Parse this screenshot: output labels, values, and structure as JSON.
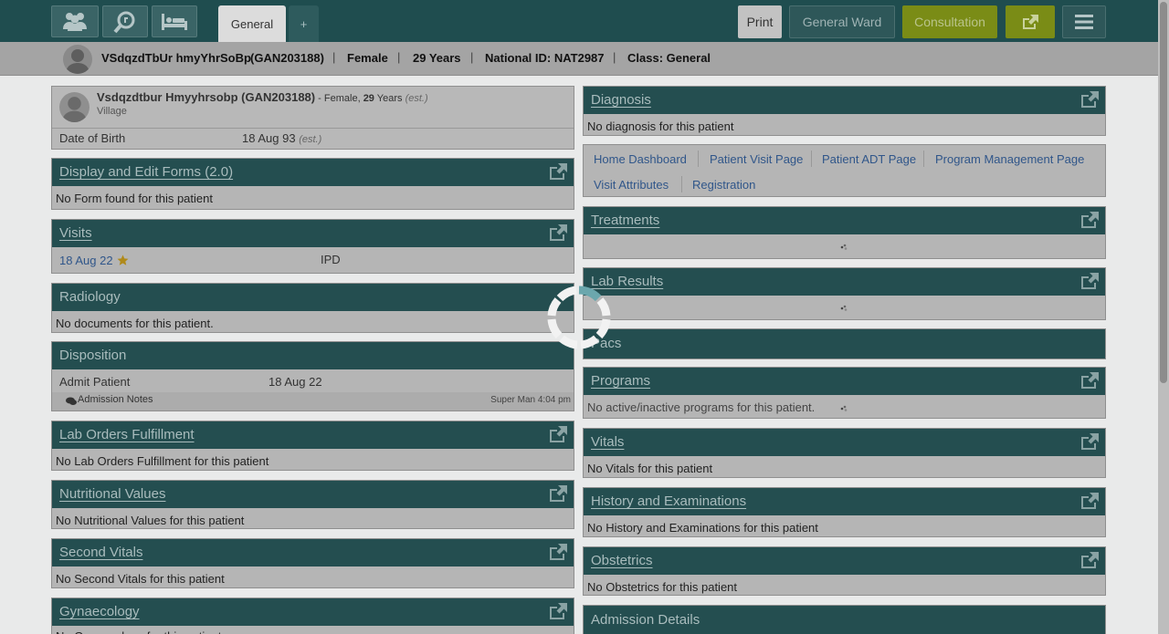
{
  "topnav": {
    "tabs": [
      "General",
      "+"
    ],
    "print": "Print",
    "ward": "General Ward",
    "consultation": "Consultation"
  },
  "patient_bar": {
    "name": "VSdqzdTbUr hmyYhrSoBp",
    "id": "(GAN203188)",
    "gender": "Female",
    "age": "29 Years",
    "national_id": "National ID: NAT2987",
    "class": "Class: General"
  },
  "patient_card": {
    "name": "Vsdqzdtbur Hmyyhrsobp (GAN203188)",
    "suffix_gender": " - Female, ",
    "age_num": "29",
    "age_word": " Years ",
    "est": "(est.)",
    "village": "Village",
    "dob_label": "Date of Birth",
    "dob_value": "18 Aug 93",
    "dob_est": "(est.)"
  },
  "left": {
    "forms": {
      "title": "Display and Edit Forms (2.0)",
      "body": "No Form found for this patient"
    },
    "visits": {
      "title": "Visits",
      "date": "18 Aug 22",
      "type": "IPD"
    },
    "radiology": {
      "title": "Radiology",
      "body": "No documents for this patient."
    },
    "disposition": {
      "title": "Disposition",
      "action": "Admit Patient",
      "date": "18 Aug 22",
      "notes": "Admission Notes",
      "by": "Super Man 4:04 pm"
    },
    "lab_orders": {
      "title": "Lab Orders Fulfillment",
      "body": "No Lab Orders Fulfillment for this patient"
    },
    "nutritional": {
      "title": "Nutritional Values",
      "body": "No Nutritional Values for this patient"
    },
    "second_vitals": {
      "title": "Second Vitals",
      "body": "No Second Vitals for this patient"
    },
    "gynaecology": {
      "title": "Gynaecology",
      "body": "No Gynaecology for this patient"
    }
  },
  "right": {
    "diagnosis": {
      "title": "Diagnosis",
      "body": "No diagnosis for this patient"
    },
    "dashboard_links": [
      "Home Dashboard",
      "Patient Visit Page",
      "Patient ADT Page",
      "Program Management Page",
      "Visit Attributes",
      "Registration"
    ],
    "treatments": {
      "title": "Treatments"
    },
    "lab_results": {
      "title": "Lab Results"
    },
    "pacs": {
      "title": "Pacs"
    },
    "programs": {
      "title": "Programs",
      "body": "No active/inactive programs for this patient."
    },
    "vitals": {
      "title": "Vitals",
      "body": "No Vitals for this patient"
    },
    "history": {
      "title": "History and Examinations",
      "body": "No History and Examinations for this patient"
    },
    "obstetrics": {
      "title": "Obstetrics",
      "body": "No Obstetrics for this patient"
    },
    "admission": {
      "title": "Admission Details"
    }
  }
}
